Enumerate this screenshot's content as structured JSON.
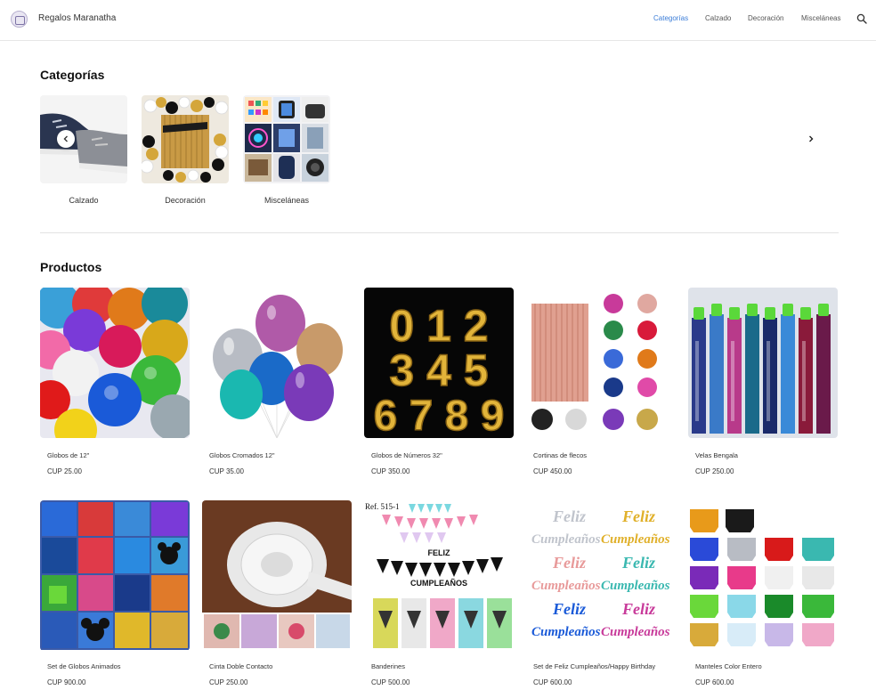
{
  "header": {
    "brand": "Regalos Maranatha",
    "nav": [
      "Categorías",
      "Calzado",
      "Decoración",
      "Misceláneas"
    ],
    "active_nav": "Categorías",
    "accent_color": "#3b7dd8"
  },
  "categories": {
    "title": "Categorías",
    "items": [
      {
        "label": "Calzado"
      },
      {
        "label": "Decoración"
      },
      {
        "label": "Misceláneas"
      }
    ],
    "prev_icon": "chevron-left-icon",
    "next_icon": "chevron-right-icon"
  },
  "products": {
    "title": "Productos",
    "items": [
      {
        "name": "Globos de 12\"",
        "price": "CUP 25.00"
      },
      {
        "name": "Globos Cromados 12\"",
        "price": "CUP 35.00"
      },
      {
        "name": "Globos de Números 32\"",
        "price": "CUP 350.00",
        "image_text": [
          "0 1 2",
          "3 4 5",
          "6 7 8 9"
        ]
      },
      {
        "name": "Cortinas de flecos",
        "price": "CUP 450.00"
      },
      {
        "name": "Velas Bengala",
        "price": "CUP 250.00"
      },
      {
        "name": "Set de Globos Animados",
        "price": "CUP 900.00"
      },
      {
        "name": "Cinta Doble Contacto",
        "price": "CUP 250.00"
      },
      {
        "name": "Banderines",
        "price": "CUP 500.00",
        "image_text": [
          "Ref. 515-1",
          "FELIZ",
          "CUMPLEAÑOS"
        ]
      },
      {
        "name": "Set de Feliz Cumpleaños/Happy Birthday",
        "price": "CUP 600.00",
        "image_text": [
          "Feliz",
          "Cumpleaños"
        ]
      },
      {
        "name": "Manteles Color Entero",
        "price": "CUP 600.00"
      }
    ]
  }
}
